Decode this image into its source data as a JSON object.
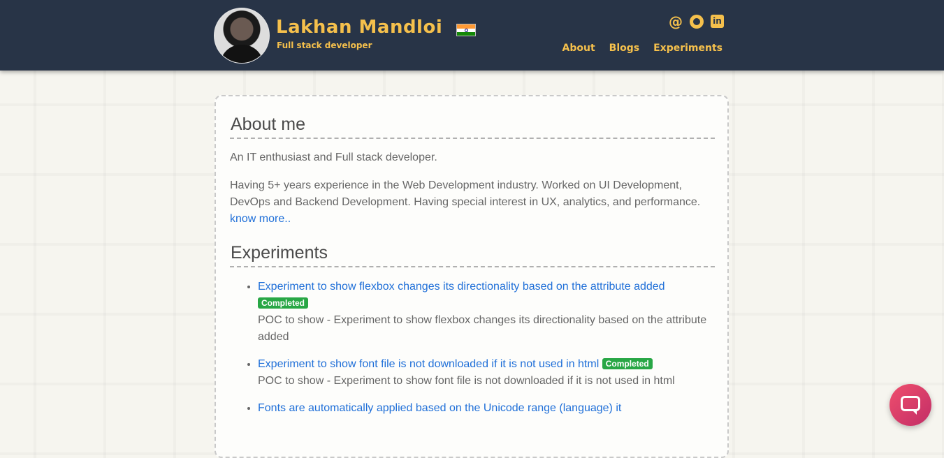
{
  "header": {
    "name": "Lakhan Mandloi",
    "subtitle": "Full stack developer",
    "social": {
      "email": "@",
      "github_icon": "github-icon",
      "linkedin": "in"
    },
    "nav": [
      "About",
      "Blogs",
      "Experiments"
    ]
  },
  "about": {
    "heading": "About me",
    "p1": "An IT enthusiast and Full stack developer.",
    "p2": "Having 5+ years experience in the Web Development industry. Worked on UI Development, DevOps and Backend Development. Having special interest in UX, analytics, and performance. ",
    "know_more": "know more.."
  },
  "experiments": {
    "heading": "Experiments",
    "items": [
      {
        "title": "Experiment to show flexbox changes its directionality based on the attribute added",
        "badge": "Completed",
        "desc": "POC to show - Experiment to show flexbox changes its directionality based on the attribute added"
      },
      {
        "title": "Experiment to show font file is not downloaded if it is not used in html",
        "badge": "Completed",
        "desc": "POC to show - Experiment to show font file is not downloaded if it is not used in html"
      },
      {
        "title": "Fonts are automatically applied based on the Unicode range (language) it",
        "badge": "",
        "desc": ""
      }
    ]
  },
  "colors": {
    "header_bg": "#283447",
    "accent": "#f5c04c",
    "link": "#1f6fd8",
    "badge": "#28a745"
  }
}
